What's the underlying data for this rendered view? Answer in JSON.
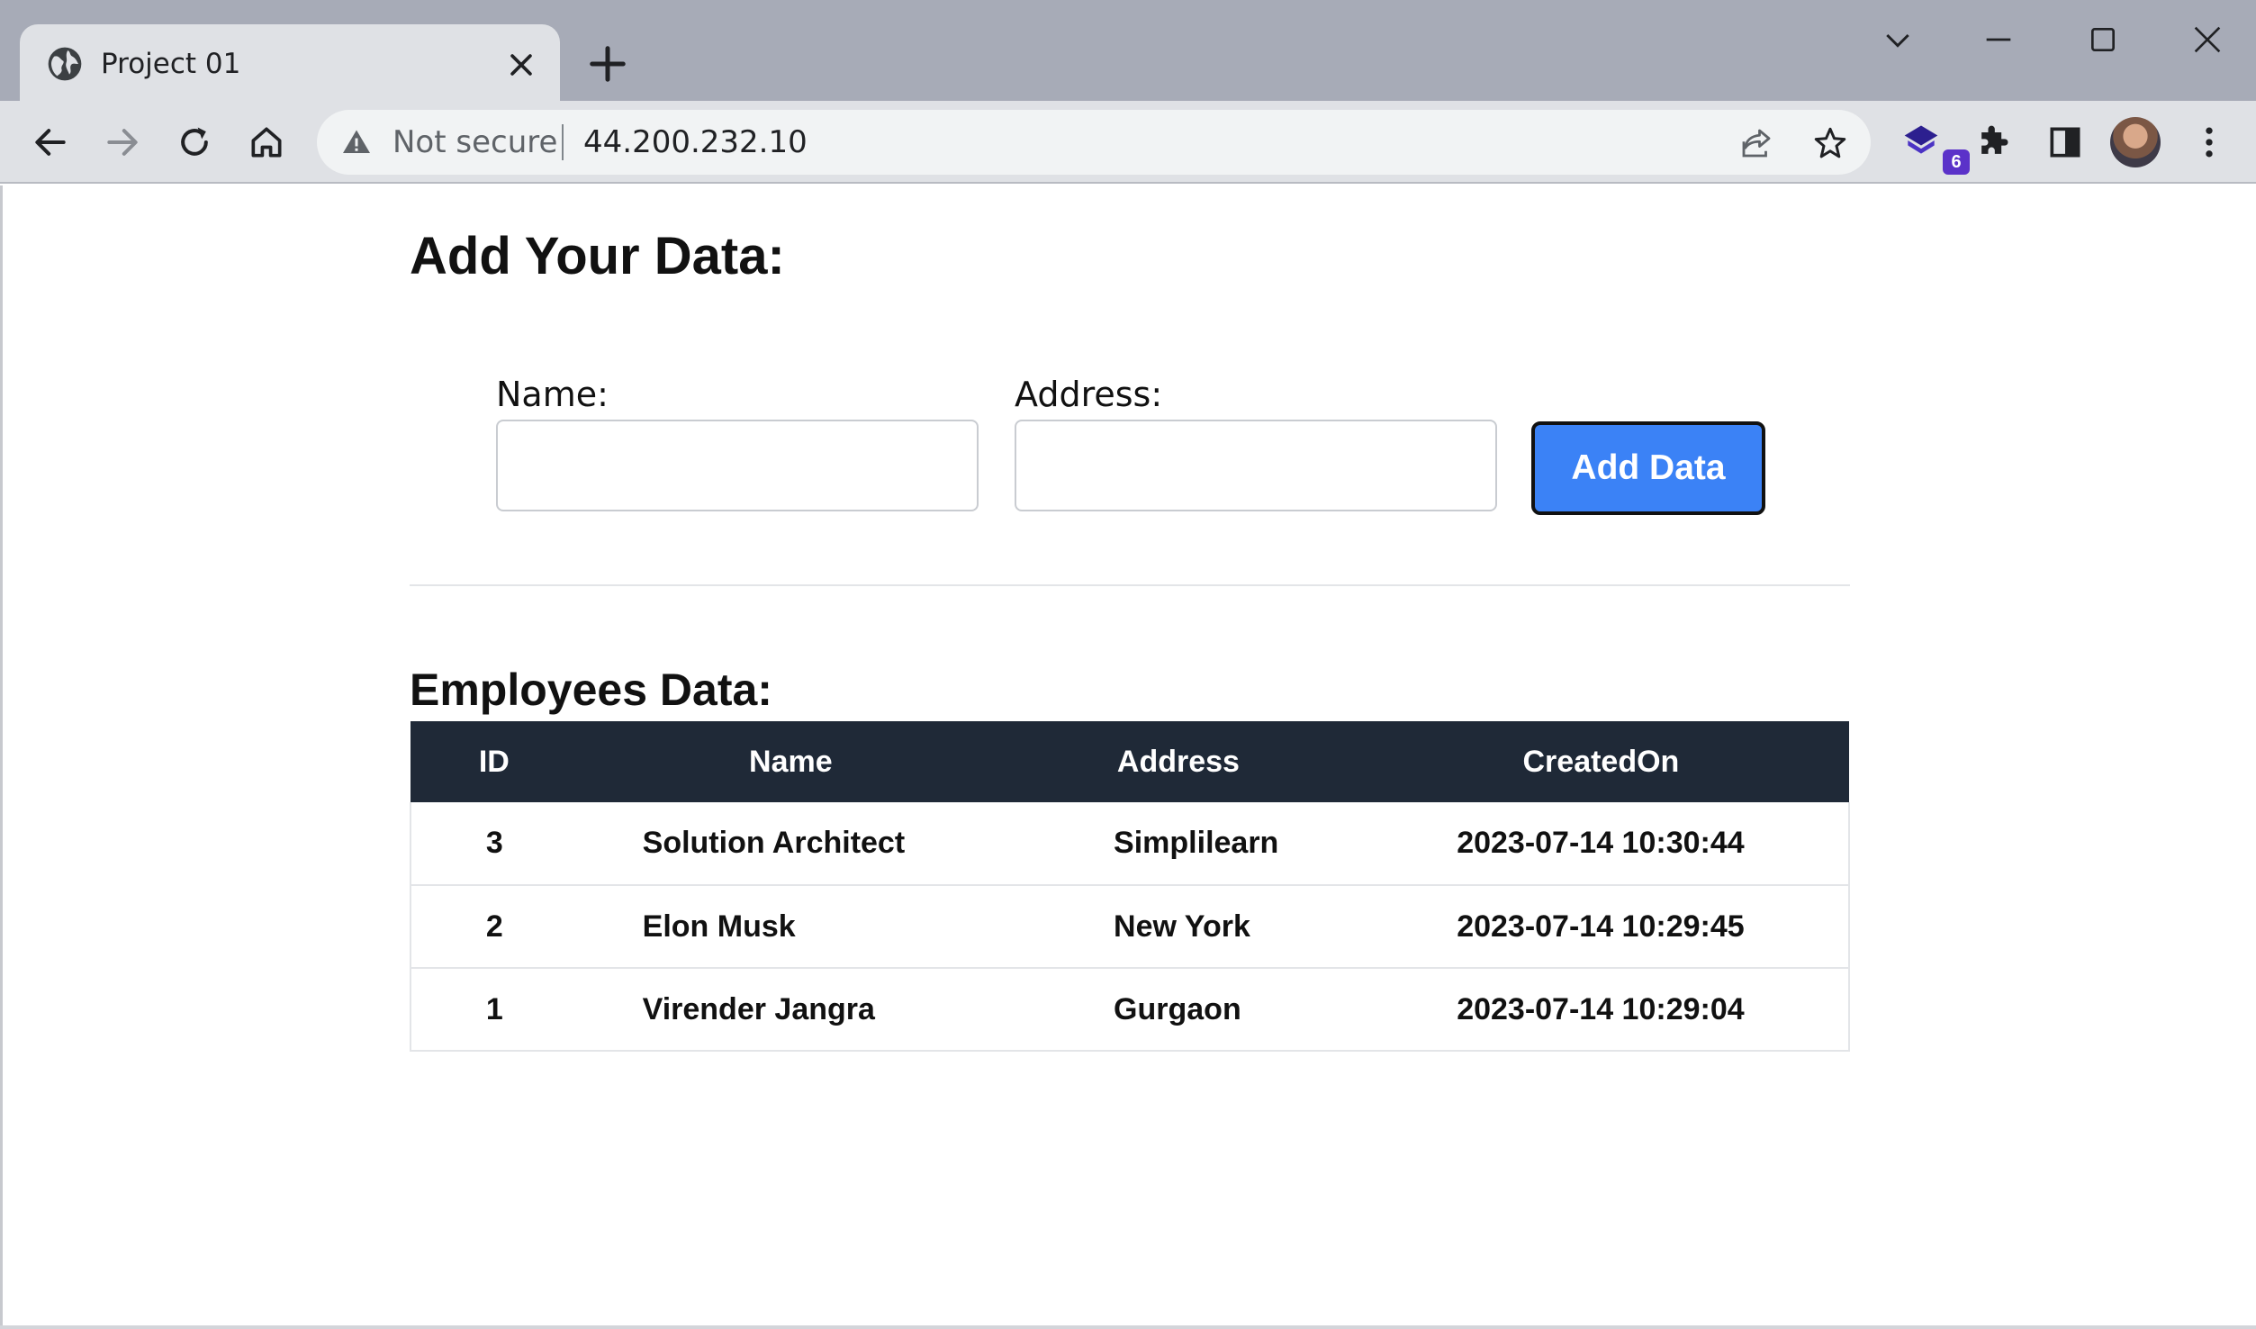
{
  "browser": {
    "tab_title": "Project 01",
    "security_label": "Not secure",
    "url": "44.200.232.10",
    "extension_badge": "6"
  },
  "form": {
    "heading": "Add Your Data:",
    "name_label": "Name:",
    "name_value": "",
    "address_label": "Address:",
    "address_value": "",
    "submit_label": "Add Data"
  },
  "employees": {
    "heading": "Employees Data:",
    "columns": [
      "ID",
      "Name",
      "Address",
      "CreatedOn"
    ],
    "rows": [
      {
        "id": "3",
        "name": "Solution Architect",
        "address": "Simplilearn",
        "created_on": "2023-07-14 10:30:44"
      },
      {
        "id": "2",
        "name": "Elon Musk",
        "address": "New York",
        "created_on": "2023-07-14 10:29:45"
      },
      {
        "id": "1",
        "name": "Virender Jangra",
        "address": "Gurgaon",
        "created_on": "2023-07-14 10:29:04"
      }
    ]
  },
  "colors": {
    "button_accent": "#3b82f6",
    "table_header_bg": "#1f2937",
    "tabstrip_bg": "#a7abb7"
  }
}
